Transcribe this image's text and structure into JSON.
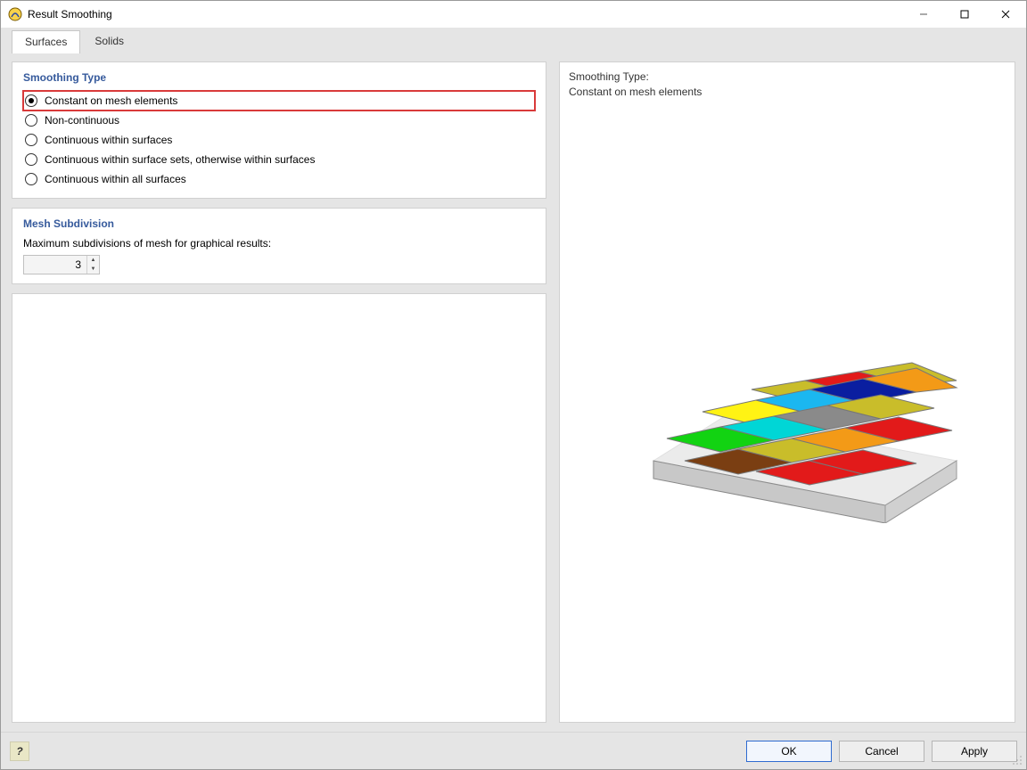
{
  "window": {
    "title": "Result Smoothing",
    "controls": {
      "minimize": "minimize",
      "maximize": "maximize",
      "close": "close"
    }
  },
  "tabs": [
    {
      "label": "Surfaces",
      "active": true
    },
    {
      "label": "Solids",
      "active": false
    }
  ],
  "smoothing": {
    "title": "Smoothing Type",
    "options": [
      {
        "label": "Constant on mesh elements",
        "checked": true,
        "highlight": true
      },
      {
        "label": "Non-continuous",
        "checked": false,
        "highlight": false
      },
      {
        "label": "Continuous within surfaces",
        "checked": false,
        "highlight": false
      },
      {
        "label": "Continuous within surface sets, otherwise within surfaces",
        "checked": false,
        "highlight": false
      },
      {
        "label": "Continuous within all surfaces",
        "checked": false,
        "highlight": false
      }
    ]
  },
  "mesh": {
    "title": "Mesh Subdivision",
    "caption": "Maximum subdivisions of mesh for graphical results:",
    "value": "3"
  },
  "preview": {
    "heading": "Smoothing Type:",
    "value": "Constant on mesh elements"
  },
  "footer": {
    "ok": "OK",
    "cancel": "Cancel",
    "apply": "Apply"
  },
  "colors": {
    "accent": "#365a9c",
    "highlight": "#d93a3a"
  }
}
